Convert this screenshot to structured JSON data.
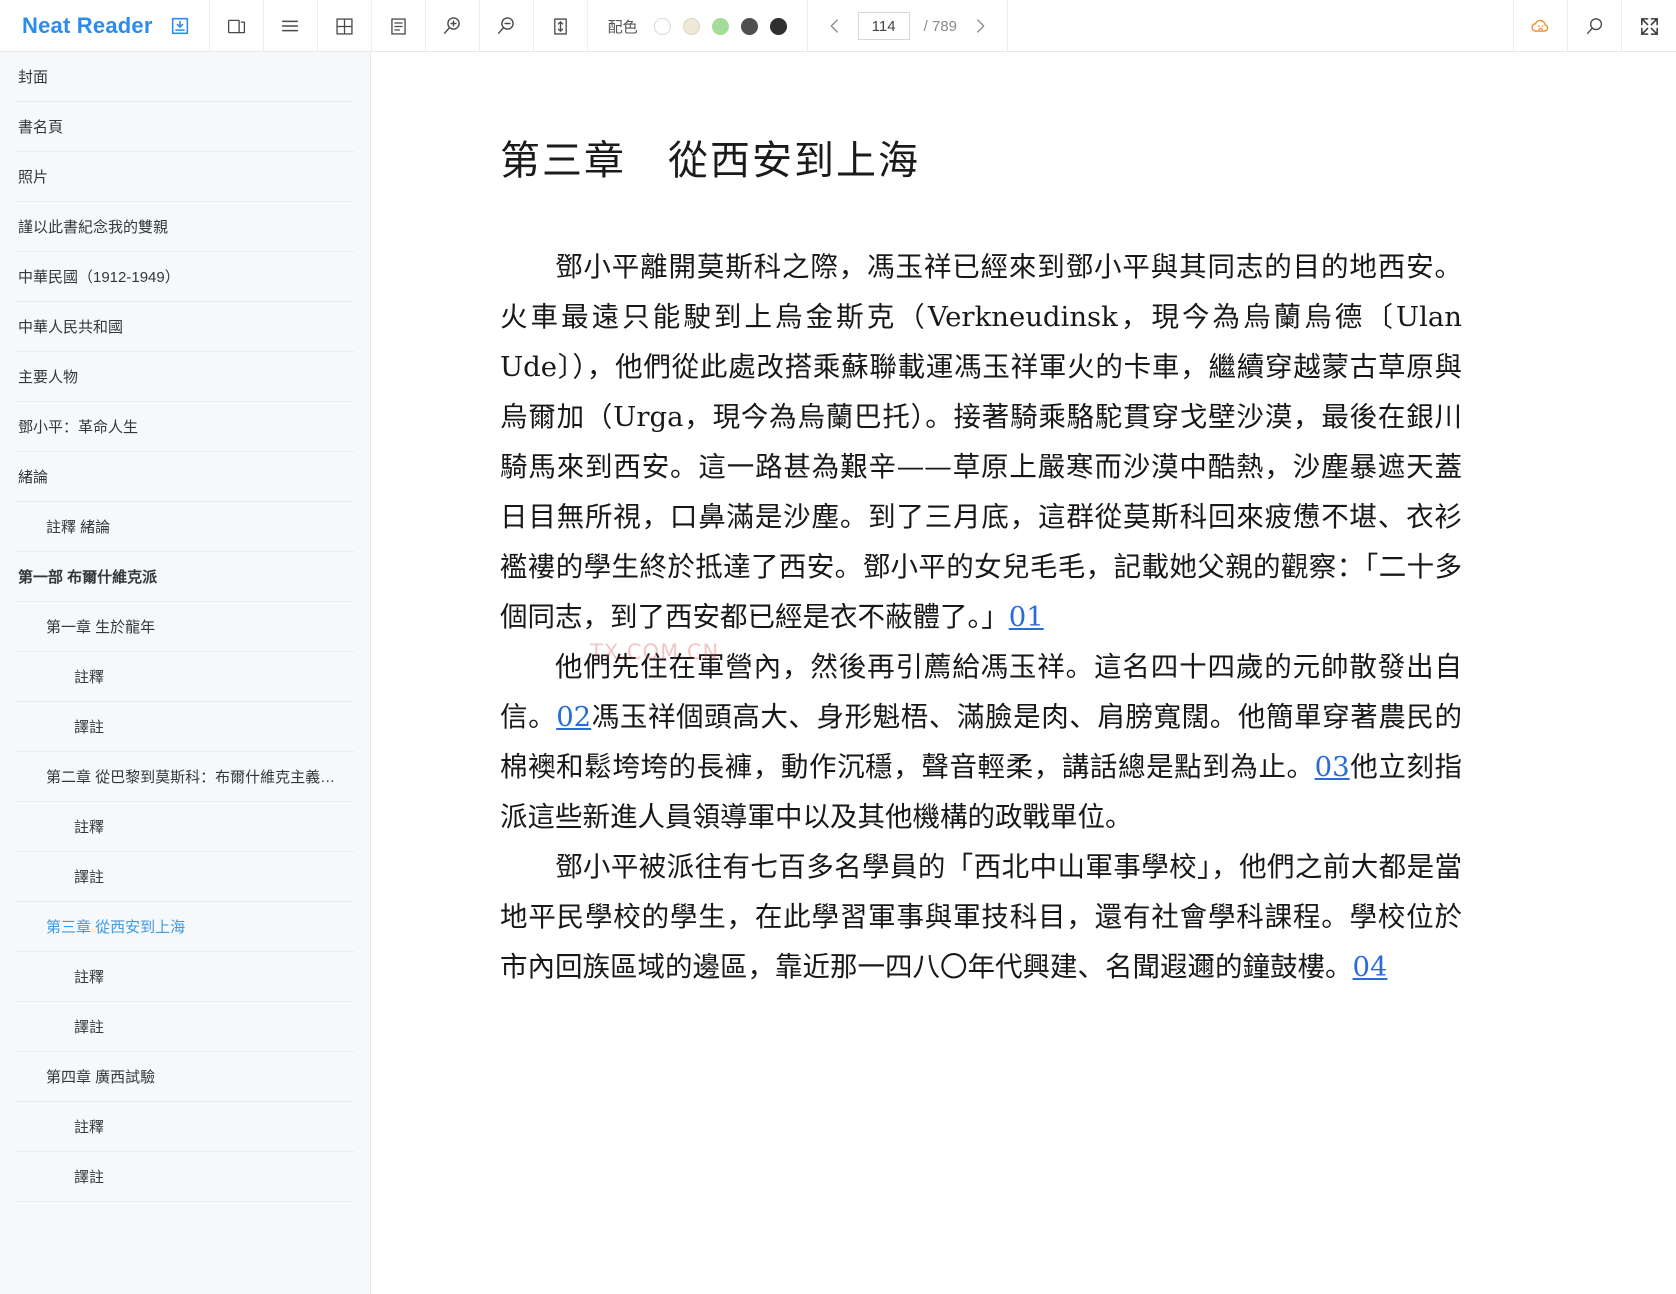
{
  "app": {
    "brand": "Neat Reader",
    "brand_color": "#2b8cf0"
  },
  "toolbar": {
    "icons": [
      {
        "name": "save-to-library-icon",
        "label": "save-to-library"
      },
      {
        "name": "book-shelf-icon",
        "label": "book-shelf"
      },
      {
        "name": "contents-list-icon",
        "label": "contents-list"
      },
      {
        "name": "grid-layout-icon",
        "label": "grid-layout"
      },
      {
        "name": "notes-panel-icon",
        "label": "notes-panel"
      },
      {
        "name": "zoom-in-icon",
        "label": "zoom-in"
      },
      {
        "name": "zoom-out-icon",
        "label": "zoom-out"
      },
      {
        "name": "line-height-icon",
        "label": "line-height"
      }
    ],
    "palette_label": "配色",
    "palette_swatches": [
      {
        "name": "theme-white",
        "color": "#ffffff",
        "border": "#d8d8d8",
        "selected": false
      },
      {
        "name": "theme-sepia",
        "color": "#efe8d8",
        "border": "#ddd5c2",
        "selected": false
      },
      {
        "name": "theme-green",
        "color": "#a6dc9a",
        "border": "#a6dc9a",
        "selected": false
      },
      {
        "name": "theme-gray",
        "color": "#4f4f4f",
        "border": "#4f4f4f",
        "selected": false
      },
      {
        "name": "theme-black",
        "color": "#2f2f2f",
        "border": "#2f2f2f",
        "selected": false
      }
    ],
    "pager": {
      "prev_label": "‹",
      "next_label": "›",
      "current_page": "114",
      "total_label": "/ 789",
      "placeholder": "114"
    },
    "right_icons": [
      {
        "name": "cloud-sync-icon",
        "label": "cloud-sync",
        "color": "#f08a24"
      },
      {
        "name": "search-icon",
        "label": "search"
      },
      {
        "name": "fullscreen-icon",
        "label": "fullscreen"
      }
    ]
  },
  "sidebar": {
    "items": [
      {
        "label": "封面",
        "level": 0,
        "active": false,
        "bold": false
      },
      {
        "label": "書名頁",
        "level": 0,
        "active": false,
        "bold": false
      },
      {
        "label": "照片",
        "level": 0,
        "active": false,
        "bold": false
      },
      {
        "label": "謹以此書紀念我的雙親",
        "level": 0,
        "active": false,
        "bold": false
      },
      {
        "label": "中華民國（1912-1949）",
        "level": 0,
        "active": false,
        "bold": false
      },
      {
        "label": "中華人民共和國",
        "level": 0,
        "active": false,
        "bold": false
      },
      {
        "label": "主要人物",
        "level": 0,
        "active": false,
        "bold": false
      },
      {
        "label": "鄧小平：革命人生",
        "level": 0,
        "active": false,
        "bold": false
      },
      {
        "label": "緒論",
        "level": 0,
        "active": false,
        "bold": false
      },
      {
        "label": "註釋 緒論",
        "level": 1,
        "active": false,
        "bold": false
      },
      {
        "label": "第一部 布爾什維克派",
        "level": 0,
        "active": false,
        "bold": true
      },
      {
        "label": "第一章 生於龍年",
        "level": 1,
        "active": false,
        "bold": false
      },
      {
        "label": "註釋",
        "level": 2,
        "active": false,
        "bold": false
      },
      {
        "label": "譯註",
        "level": 2,
        "active": false,
        "bold": false
      },
      {
        "label": "第二章 從巴黎到莫斯科：布爾什維克主義…",
        "level": 1,
        "active": false,
        "bold": false
      },
      {
        "label": "註釋",
        "level": 2,
        "active": false,
        "bold": false
      },
      {
        "label": "譯註",
        "level": 2,
        "active": false,
        "bold": false
      },
      {
        "label": "第三章 從西安到上海",
        "level": 1,
        "active": true,
        "bold": false
      },
      {
        "label": "註釋",
        "level": 2,
        "active": false,
        "bold": false
      },
      {
        "label": "譯註",
        "level": 2,
        "active": false,
        "bold": false
      },
      {
        "label": "第四章 廣西試驗",
        "level": 1,
        "active": false,
        "bold": false
      },
      {
        "label": "註釋",
        "level": 2,
        "active": false,
        "bold": false
      },
      {
        "label": "譯註",
        "level": 2,
        "active": false,
        "bold": false
      }
    ]
  },
  "content": {
    "chapter_title": "第三章　從西安到上海",
    "watermark": "TX.COM.CN",
    "paragraphs": [
      {
        "id": "para-1",
        "runs": [
          {
            "type": "text",
            "text": "鄧小平離開莫斯科之際，馮玉祥已經來到鄧小平與其同志的目的地西安。火車最遠只能駛到上烏金斯克（Verkneudinsk，現今為烏蘭烏德〔Ulan Ude〕），他們從此處改搭乘蘇聯載運馮玉祥軍火的卡車，繼續穿越蒙古草原與烏爾加（Urga，現今為烏蘭巴托）。接著騎乘駱駝貫穿戈壁沙漠，最後在銀川騎馬來到西安。這一路甚為艱辛——草原上嚴寒而沙漠中酷熱，沙塵暴遮天蓋日目無所視，口鼻滿是沙塵。到了三月底，這群從莫斯科回來疲憊不堪、衣衫襤褸的學生終於抵達了西安。鄧小平的女兒毛毛，記載她父親的觀察：「二十多個同志，到了西安都已經是衣不蔽體了。」"
          },
          {
            "type": "fnref",
            "text": "01"
          }
        ]
      },
      {
        "id": "para-2",
        "runs": [
          {
            "type": "text",
            "text": "他們先住在軍營內，然後再引薦給馮玉祥。這名四十四歲的元帥散發出自信。"
          },
          {
            "type": "fnref",
            "text": "02"
          },
          {
            "type": "text",
            "text": "馮玉祥個頭高大、身形魁梧、滿臉是肉、肩膀寬闊。他簡單穿著農民的棉襖和鬆垮垮的長褲，動作沉穩，聲音輕柔，講話總是點到為止。"
          },
          {
            "type": "fnref",
            "text": "03"
          },
          {
            "type": "text",
            "text": "他立刻指派這些新進人員領導軍中以及其他機構的政戰單位。"
          }
        ]
      },
      {
        "id": "para-3",
        "runs": [
          {
            "type": "text",
            "text": "鄧小平被派往有七百多名學員的「西北中山軍事學校」，他們之前大都是當地平民學校的學生，在此學習軍事與軍技科目，還有社會學科課程。學校位於市內回族區域的邊區，靠近那一四八〇年代興建、名聞遐邇的鐘鼓樓。"
          },
          {
            "type": "fnref",
            "text": "04"
          }
        ]
      }
    ]
  }
}
